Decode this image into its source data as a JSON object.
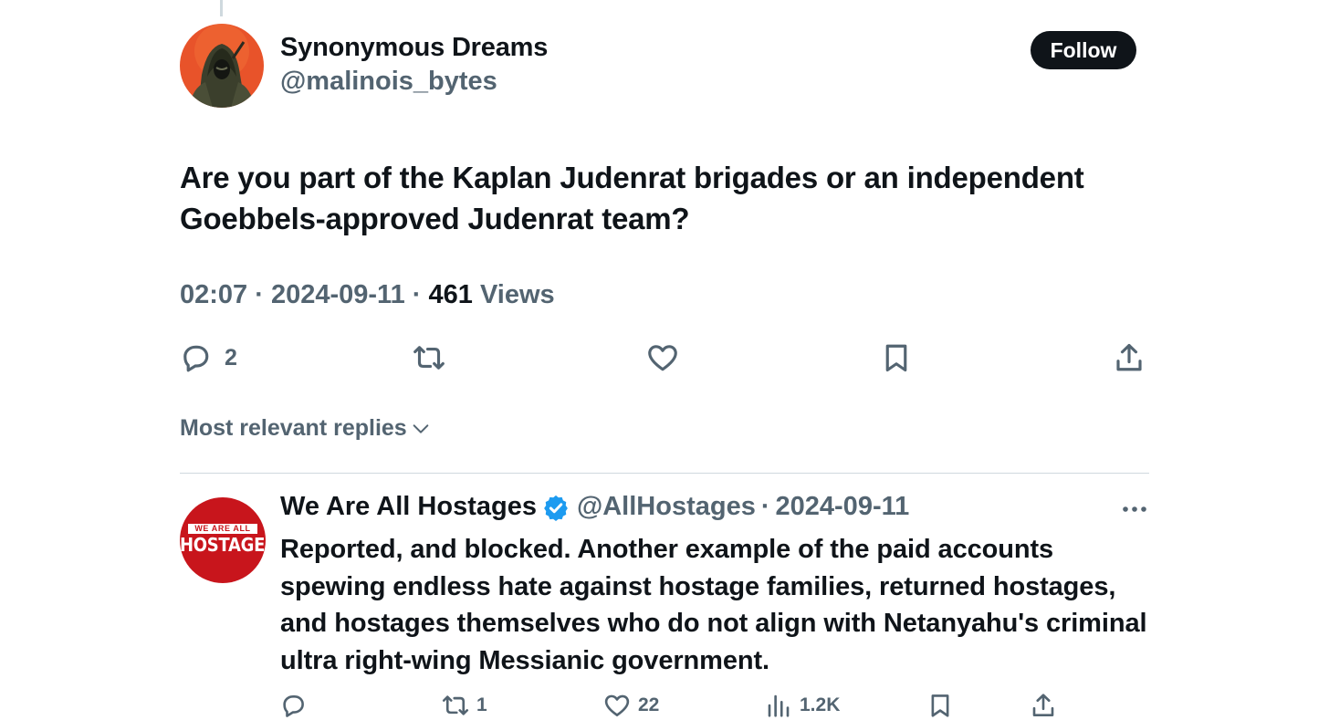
{
  "tweet": {
    "author_name": "Synonymous Dreams",
    "author_handle": "@malinois_bytes",
    "follow_label": "Follow",
    "text": "Are you part of the Kaplan Judenrat brigades or an independent Goebbels-approved Judenrat team?",
    "time": "02:07",
    "date": "2024-09-11",
    "separator": "·",
    "views_count": "461",
    "views_label": "Views",
    "reply_count": "2"
  },
  "replies_sort": {
    "label": "Most relevant replies"
  },
  "reply": {
    "avatar_text_top": "WE ARE ALL",
    "avatar_text_bottom": "HOSTAGES",
    "name": "We Are All Hostages",
    "handle": "@AllHostages",
    "separator": "·",
    "date": "2024-09-11",
    "text": "Reported, and blocked. Another example of the paid accounts spewing endless hate against hostage families, returned hostages, and hostages themselves who do not align with Netanyahu's criminal ultra right-wing Messianic government.",
    "retweet_count": "1",
    "like_count": "22",
    "views_count": "1.2K"
  },
  "colors": {
    "text_primary": "#0f1419",
    "text_secondary": "#536471",
    "divider": "#cfd9de",
    "verified_blue": "#1d9bf0",
    "hostages_red": "#c8151c"
  },
  "icons": {
    "reply": "speech-bubble-icon",
    "retweet": "retweet-icon",
    "like": "heart-icon",
    "bookmark": "bookmark-icon",
    "share": "share-icon",
    "views": "bar-chart-icon",
    "more": "ellipsis-icon",
    "verified": "verified-badge-icon",
    "sort": "chevron-down-icon"
  }
}
